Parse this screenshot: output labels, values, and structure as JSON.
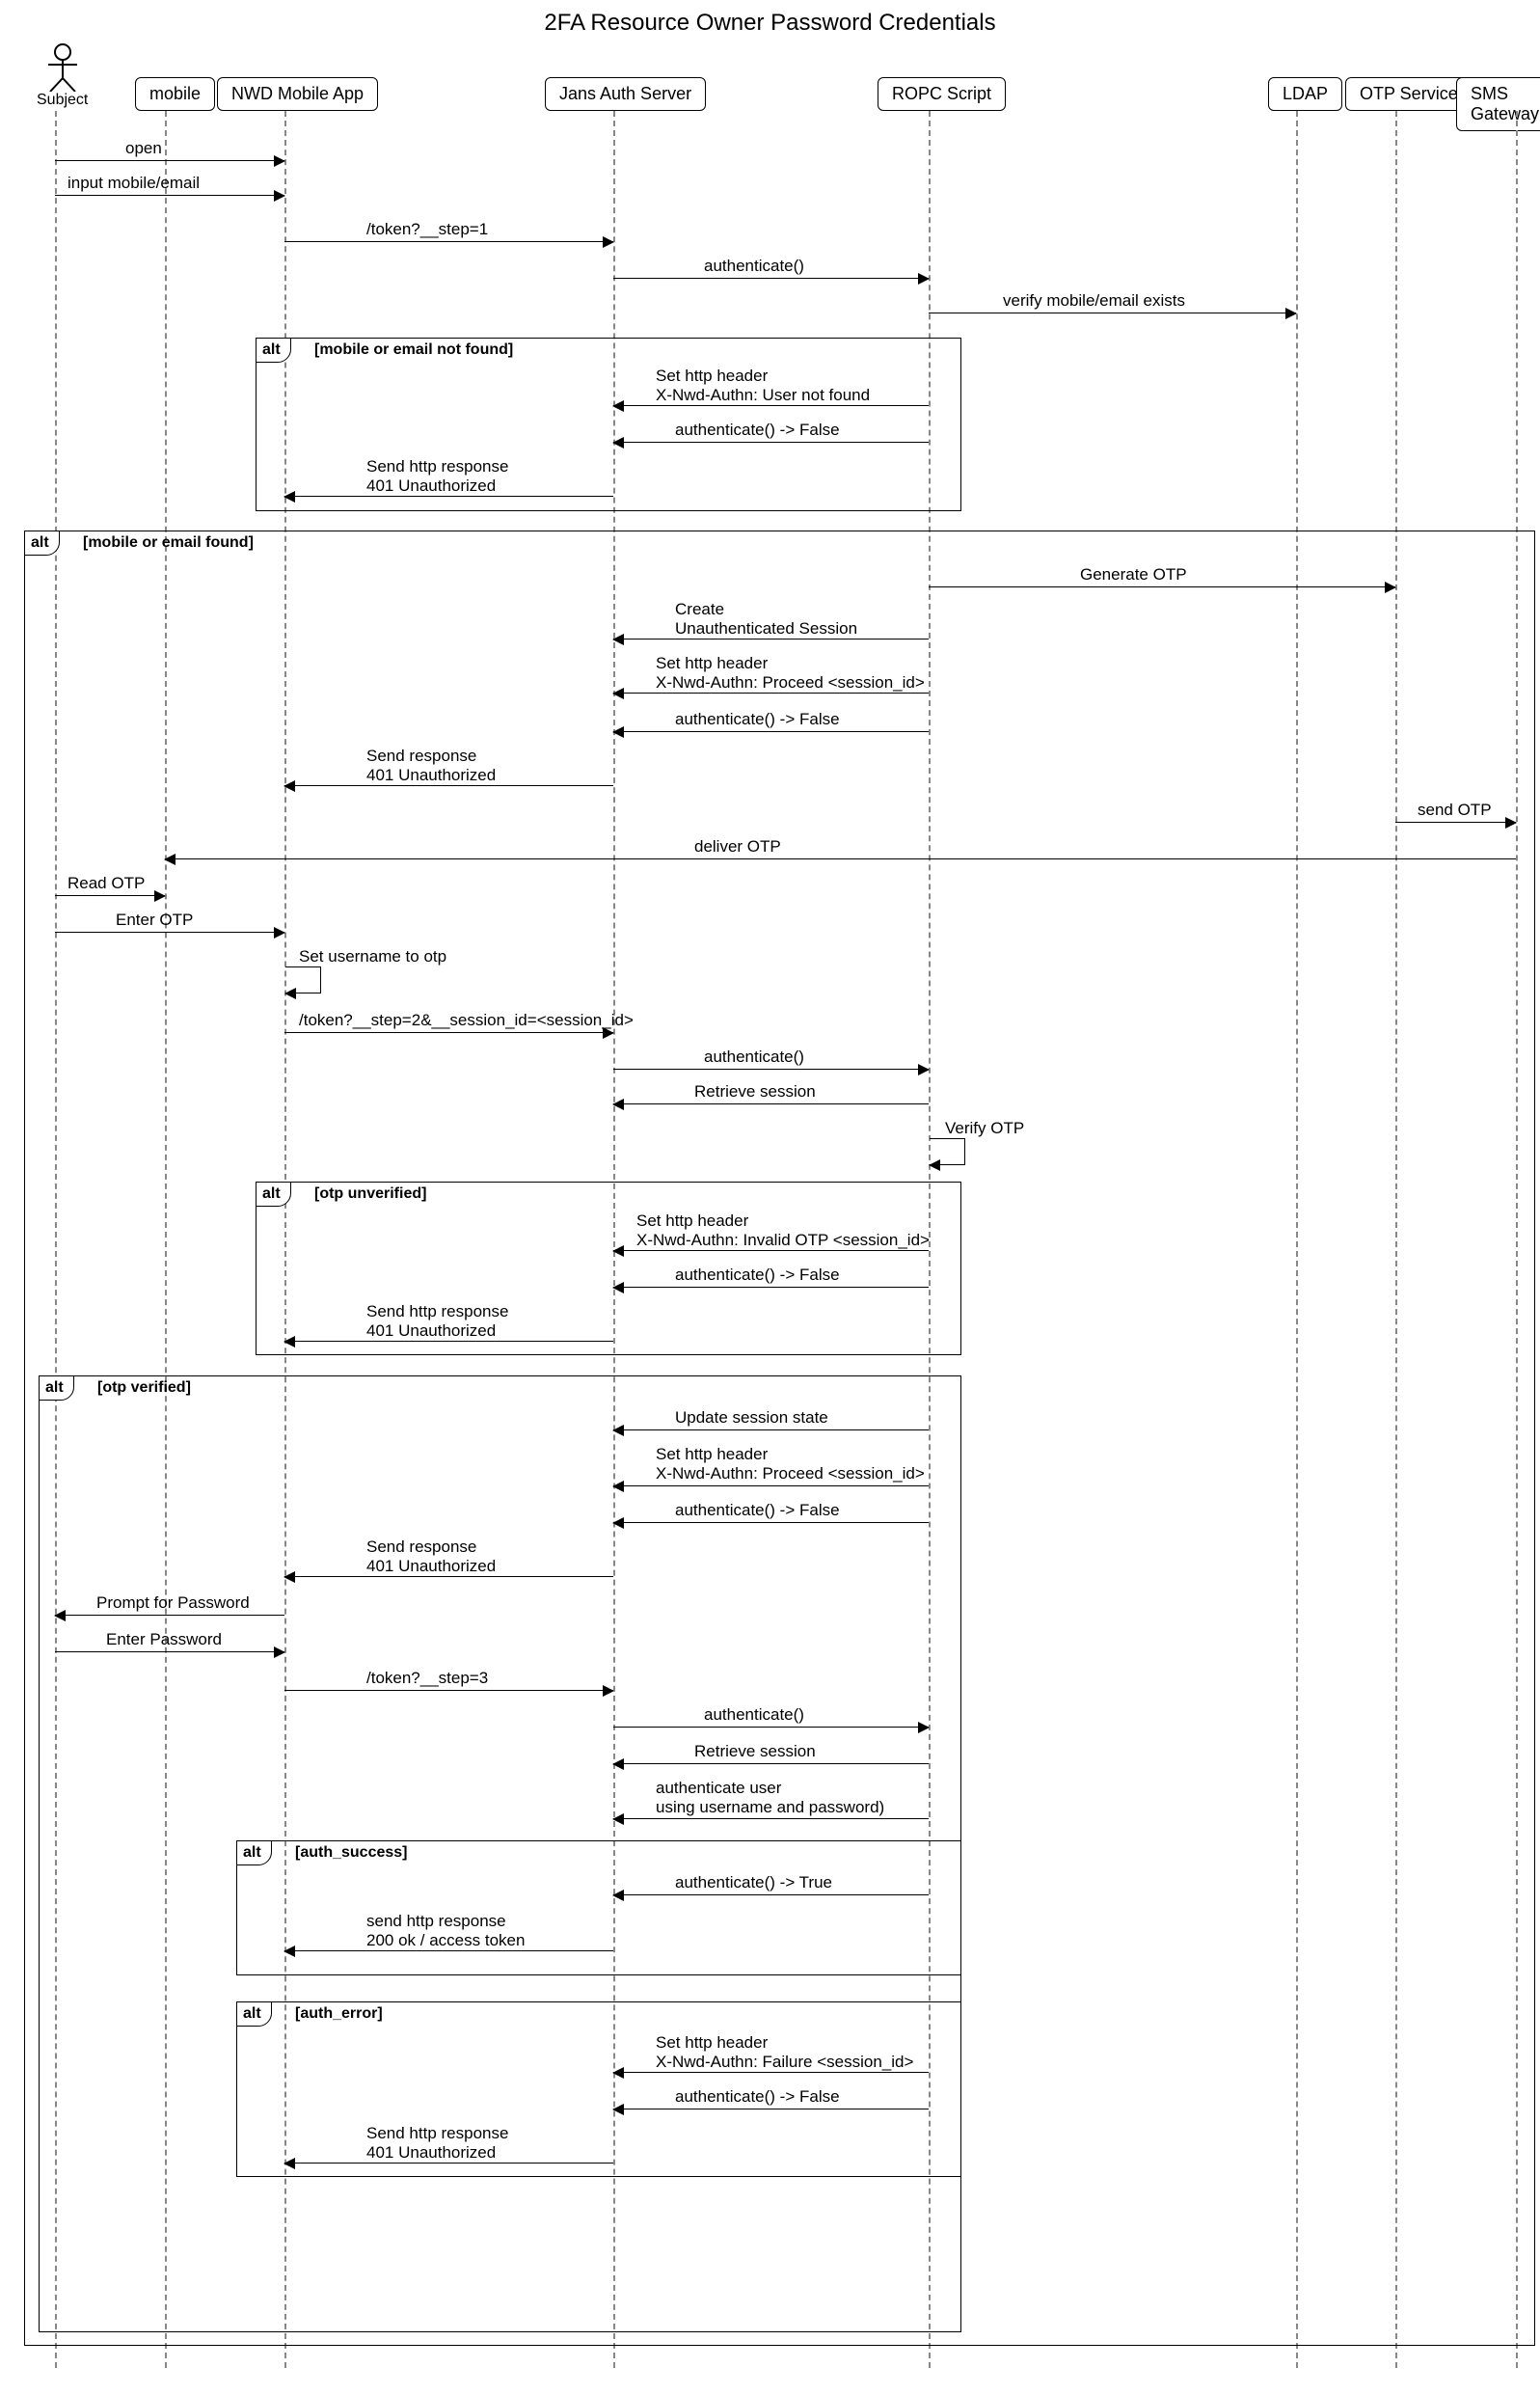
{
  "title": "2FA Resource Owner Password Credentials",
  "participants": {
    "subject": "Subject",
    "mobile": "mobile",
    "app": "NWD Mobile App",
    "jans": "Jans Auth Server",
    "ropc": "ROPC Script",
    "ldap": "LDAP",
    "otp": "OTP Service",
    "sms": "SMS Gateway"
  },
  "alts": {
    "notfound": {
      "label": "alt",
      "cond": "[mobile or email not found]"
    },
    "found": {
      "label": "alt",
      "cond": "[mobile or email found]"
    },
    "otp_unverified": {
      "label": "alt",
      "cond": "[otp unverified]"
    },
    "otp_verified": {
      "label": "alt",
      "cond": "[otp verified]"
    },
    "auth_success": {
      "label": "alt",
      "cond": "[auth_success]"
    },
    "auth_error": {
      "label": "alt",
      "cond": "[auth_error]"
    }
  },
  "msgs": {
    "open": "open",
    "input_me": "input mobile/email",
    "token1": "/token?__step=1",
    "auth": "authenticate()",
    "verify_me": "verify mobile/email exists",
    "hdr_nf1": "Set http header",
    "hdr_nf2": "X-Nwd-Authn: User not found",
    "auth_false": "authenticate() -> False",
    "resp401a": "Send http response",
    "resp401b": "401 Unauthorized",
    "gen_otp": "Generate OTP",
    "create_sess1": "Create",
    "create_sess2": "Unauthenticated Session",
    "hdr_proceed1": "Set http header",
    "hdr_proceed2": "X-Nwd-Authn: Proceed <session_id>",
    "send_resp1": "Send response",
    "send_resp2": "401 Unauthorized",
    "send_otp": "send OTP",
    "deliver_otp": "deliver OTP",
    "read_otp": "Read OTP",
    "enter_otp": "Enter OTP",
    "set_user_otp": "Set username to otp",
    "token2": "/token?__step=2&__session_id=<session_id>",
    "retrieve_sess": "Retrieve session",
    "verify_otp": "Verify OTP",
    "hdr_inv1": "Set http header",
    "hdr_inv2": "X-Nwd-Authn: Invalid OTP <session_id>",
    "update_sess": "Update session state",
    "prompt_pw": "Prompt for Password",
    "enter_pw": "Enter Password",
    "token3": "/token?__step=3",
    "auth_user1": "authenticate user",
    "auth_user2": "using username and password)",
    "auth_true": "authenticate() -> True",
    "resp200a": "send http response",
    "resp200b": "200 ok / access token",
    "hdr_fail1": "Set http header",
    "hdr_fail2": "X-Nwd-Authn: Failure <session_id>"
  }
}
